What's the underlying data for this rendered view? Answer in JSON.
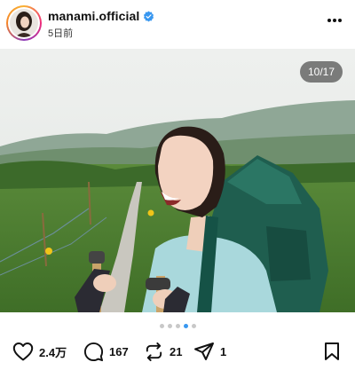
{
  "post": {
    "username": "manami.official",
    "timestamp": "5日前",
    "image_counter": "10/17",
    "carousel": {
      "total_dots": 5,
      "active_dot": 4
    }
  },
  "actions": {
    "likes": "2.4万",
    "comments": "167",
    "reposts": "21",
    "shares": "1"
  },
  "icons": {
    "verified": "verified-badge-icon",
    "more": "more-icon",
    "like": "heart-icon",
    "comment": "comment-icon",
    "repost": "repost-icon",
    "share": "send-icon",
    "bookmark": "bookmark-icon"
  },
  "colors": {
    "accent": "#3897f0",
    "verified": "#3897f0"
  }
}
